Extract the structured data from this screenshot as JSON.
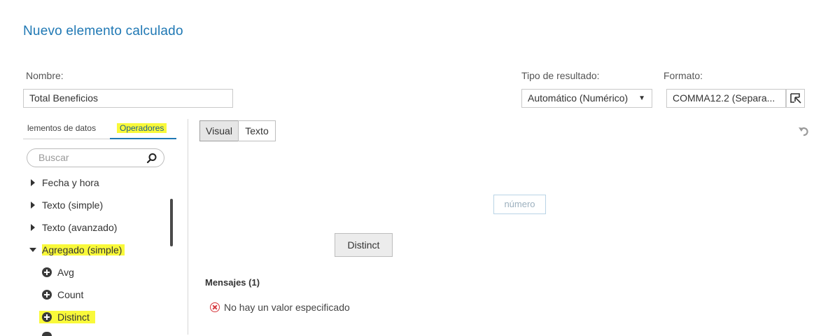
{
  "dialog": {
    "title": "Nuevo elemento calculado"
  },
  "form": {
    "name_label": "Nombre:",
    "name_value": "Total Beneficios",
    "result_type_label": "Tipo de resultado:",
    "result_type_value": "Automático (Numérico)",
    "format_label": "Formato:",
    "format_value": "COMMA12.2 (Separa..."
  },
  "left_panel": {
    "tabs": [
      {
        "label": "lementos de datos",
        "active": false
      },
      {
        "label": "Operadores",
        "active": true
      }
    ],
    "search_placeholder": "Buscar",
    "tree": [
      {
        "label": "Fecha y hora",
        "type": "group",
        "expanded": false
      },
      {
        "label": "Texto (simple)",
        "type": "group",
        "expanded": false
      },
      {
        "label": "Texto (avanzado)",
        "type": "group",
        "expanded": false
      },
      {
        "label": "Agregado (simple)",
        "type": "group",
        "expanded": true
      },
      {
        "label": "Avg",
        "type": "operator"
      },
      {
        "label": "Count",
        "type": "operator"
      },
      {
        "label": "Distinct",
        "type": "operator"
      }
    ]
  },
  "editor": {
    "mode_tabs": [
      {
        "label": "Visual",
        "selected": true
      },
      {
        "label": "Texto",
        "selected": false
      }
    ],
    "placeholder": "número",
    "function_box": "Distinct"
  },
  "messages": {
    "title": "Mensajes (1)",
    "items": [
      {
        "text": "No hay un valor especificado",
        "level": "error"
      }
    ]
  },
  "colors": {
    "accent": "#1f78b4",
    "highlight": "#f9f93a",
    "error": "#d6373d"
  }
}
